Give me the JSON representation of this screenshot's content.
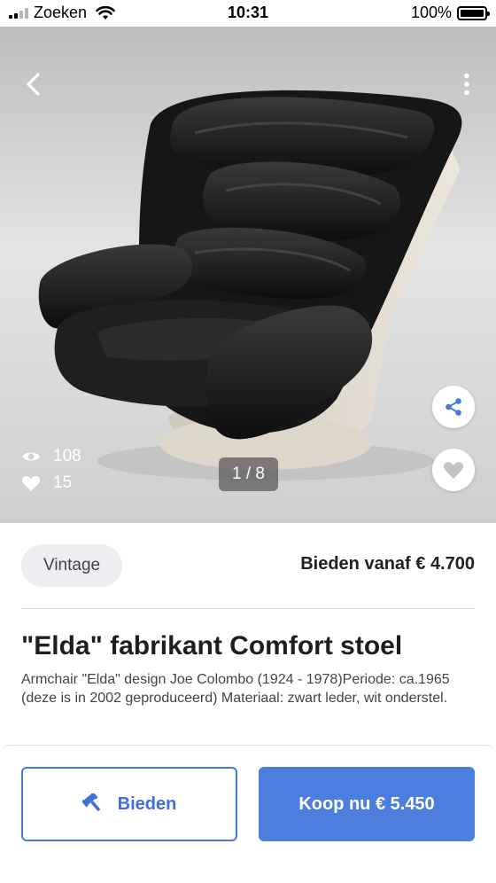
{
  "status_bar": {
    "carrier": "Zoeken",
    "time": "10:31",
    "battery": "100%",
    "battery_level": 1.0
  },
  "gallery": {
    "image_alt": "Black leather Elda armchair",
    "views": "108",
    "likes": "15",
    "pager": "1 / 8"
  },
  "product": {
    "tag": "Vintage",
    "price_from": "Bieden vanaf € 4.700",
    "title": "\"Elda\" fabrikant Comfort stoel",
    "description": "Armchair \"Elda\" design Joe Colombo (1924 - 1978)Periode: ca.1965 (deze is in 2002 geproduceerd) Materiaal: zwart leder, wit onderstel."
  },
  "actions": {
    "bid_label": "Bieden",
    "buy_label": "Koop nu € 5.450"
  },
  "icons": {
    "back": "chevron-left-icon",
    "more": "more-vertical-icon",
    "share": "share-icon",
    "favorite": "heart-icon",
    "views": "eye-icon",
    "likes": "heart-icon",
    "bid": "gavel-icon"
  },
  "colors": {
    "accent": "#4c7ee0",
    "accent_outline": "#4a79dc",
    "tag_bg": "#eceef2",
    "heart_gray": "#c4c4c4"
  }
}
